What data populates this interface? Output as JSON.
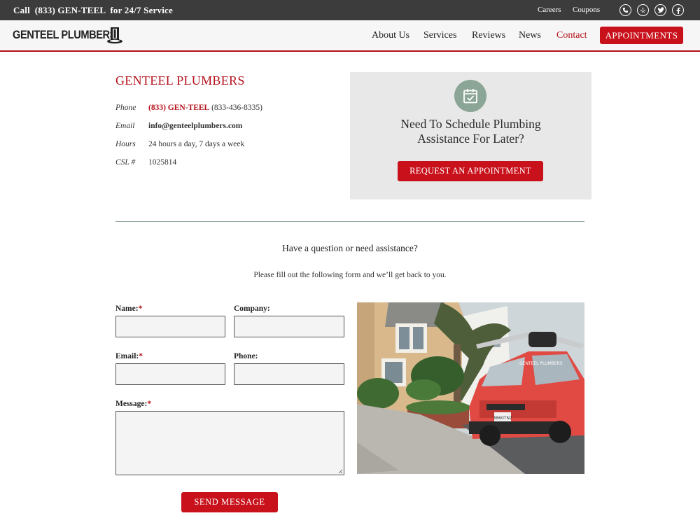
{
  "topbar": {
    "call_text": "Call  (833) GEN-TEEL  for 24/7 Service",
    "links": [
      "Careers",
      "Coupons"
    ],
    "social_icons": [
      "phone-icon",
      "yelp-icon",
      "twitter-icon",
      "facebook-icon"
    ]
  },
  "header": {
    "logo_text": "GENTEEL PLUMBERS.",
    "nav": [
      "About Us",
      "Services",
      "Reviews",
      "News",
      "Contact"
    ],
    "active_nav": "Contact",
    "cta_label": "APPOINTMENTS"
  },
  "contact": {
    "company_name": "GENTEEL PLUMBERS",
    "phone_label": "Phone",
    "phone_value": "(833) GEN-TEEL",
    "phone_digits": "(833-436-8335)",
    "email_label": "Email",
    "email_value": "info@genteelplumbers.com",
    "hours_label": "Hours",
    "hours_value": "24 hours a day, 7 days a week",
    "csl_label": "CSL #",
    "csl_value": "1025814"
  },
  "schedule": {
    "title_line1": "Need To Schedule Plumbing",
    "title_line2": "Assistance For Later?",
    "button_label": "REQUEST AN APPOINTMENT",
    "icon": "calendar-check-icon"
  },
  "form": {
    "question": "Have a question or need assistance?",
    "instructions": "Please fill out the following form and we’ll get back to you.",
    "name_label": "Name:",
    "company_label": "Company:",
    "email_label": "Email:",
    "phone_label": "Phone:",
    "message_label": "Message:",
    "required_mark": "*",
    "submit_label": "SEND MESSAGE"
  },
  "photo": {
    "van_lettering": "GENTEEL PLUMBERS",
    "plate": "3B60TN2"
  },
  "colors": {
    "accent": "#c8111b",
    "topbar": "#3c3c3c",
    "icon_circle": "#8ba596"
  }
}
